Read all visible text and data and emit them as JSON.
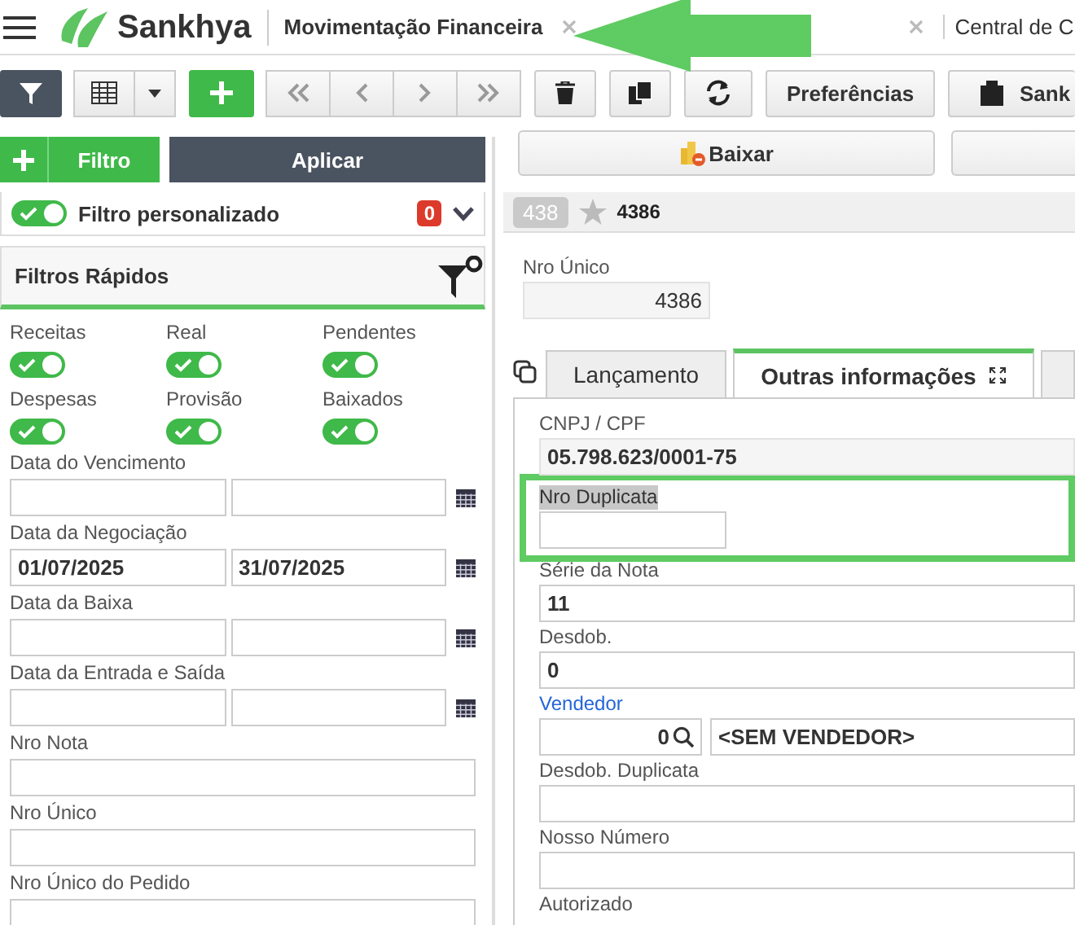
{
  "top_bar": {
    "brand": "Sankhya",
    "tabs": [
      {
        "label": "Movimentação Financeira",
        "closable": true
      },
      {
        "closable": true
      },
      {
        "label": "Central de C",
        "closable": false
      }
    ]
  },
  "toolbar": {
    "preferences_label": "Preferências",
    "extra_label": "Sank"
  },
  "left": {
    "add_filter_label": "Filtro",
    "apply_label": "Aplicar",
    "custom_filter": {
      "label": "Filtro personalizado",
      "on": true,
      "count": "0"
    },
    "quick_filters": {
      "title": "Filtros Rápidos",
      "toggles": [
        {
          "label": "Receitas",
          "on": true
        },
        {
          "label": "Real",
          "on": true
        },
        {
          "label": "Pendentes",
          "on": true
        },
        {
          "label": "Despesas",
          "on": true
        },
        {
          "label": "Provisão",
          "on": true
        },
        {
          "label": "Baixados",
          "on": true
        }
      ],
      "fields": [
        {
          "label": "Data do Vencimento",
          "kind": "range"
        },
        {
          "label": "Data da Negociação",
          "kind": "range",
          "from": "01/07/2025",
          "to": "31/07/2025"
        },
        {
          "label": "Data da Baixa",
          "kind": "range"
        },
        {
          "label": "Data da Entrada e Saída",
          "kind": "range"
        },
        {
          "label": "Nro Nota",
          "kind": "text"
        },
        {
          "label": "Nro Único",
          "kind": "text"
        },
        {
          "label": "Nro Único do Pedido",
          "kind": "text"
        }
      ]
    }
  },
  "right": {
    "action_label": "Baixar",
    "record": {
      "index": "438",
      "starred": false,
      "id": "4386"
    },
    "nro_unico": {
      "label": "Nro Único",
      "value": "4386"
    },
    "tabs": [
      {
        "label": "Lançamento",
        "selected": false
      },
      {
        "label": "Outras informações",
        "selected": true
      },
      {
        "selected": false
      }
    ],
    "fields": [
      {
        "label": "CNPJ / CPF",
        "kind": "readonly",
        "value": "05.798.623/0001-75"
      },
      {
        "label": "Nro Duplicata",
        "kind": "highlighted"
      },
      {
        "label": "Série da Nota",
        "kind": "text",
        "value": "11"
      },
      {
        "label": "Desdob.",
        "kind": "text",
        "value": "0"
      },
      {
        "label": "Vendedor",
        "kind": "lookup",
        "code": "0",
        "name": "<SEM VENDEDOR>"
      },
      {
        "label": "Desdob. Duplicata",
        "kind": "text"
      },
      {
        "label": "Nosso Número",
        "kind": "text"
      },
      {
        "label": "Autorizado",
        "kind": "label_only"
      }
    ]
  }
}
